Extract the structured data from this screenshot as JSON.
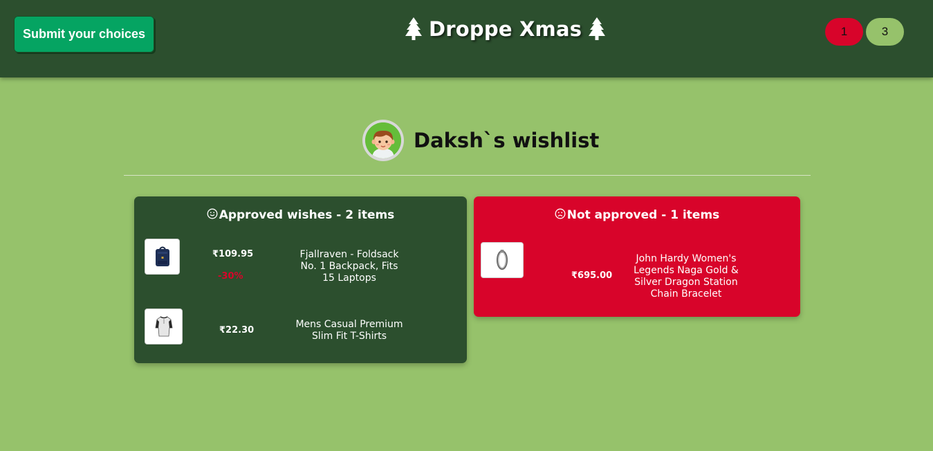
{
  "header": {
    "submit_label": "Submit your choices",
    "brand_title": "Droppe Xmas",
    "tree_icon": "christmas-tree-icon",
    "pages": [
      {
        "label": "1",
        "color": "#d8042a"
      },
      {
        "label": "3",
        "color": "#96c26b"
      }
    ]
  },
  "wishlist": {
    "title": "Daksh`s wishlist",
    "avatar_icon": "boy-avatar-icon"
  },
  "approved": {
    "title": "Approved wishes - 2 items",
    "icon": "smiley-face-icon",
    "items": [
      {
        "price": "₹109.95",
        "discount": "-30%",
        "name": "Fjallraven - Foldsack No. 1 Backpack, Fits 15 Laptops",
        "image_icon": "backpack-icon"
      },
      {
        "price": "₹22.30",
        "name": "Mens Casual Premium Slim Fit T-Shirts",
        "image_icon": "tshirt-icon"
      }
    ]
  },
  "rejected": {
    "title": "Not approved - 1 items",
    "icon": "sad-face-icon",
    "items": [
      {
        "price": "₹695.00",
        "name": "John Hardy Women's Legends Naga Gold & Silver Dragon Station Chain Bracelet",
        "image_icon": "bracelet-icon"
      }
    ]
  },
  "colors": {
    "header_bg": "#2c4f2e",
    "page_bg": "#96c26b",
    "submit_bg": "#05a462",
    "reject_bg": "#d8042a"
  }
}
